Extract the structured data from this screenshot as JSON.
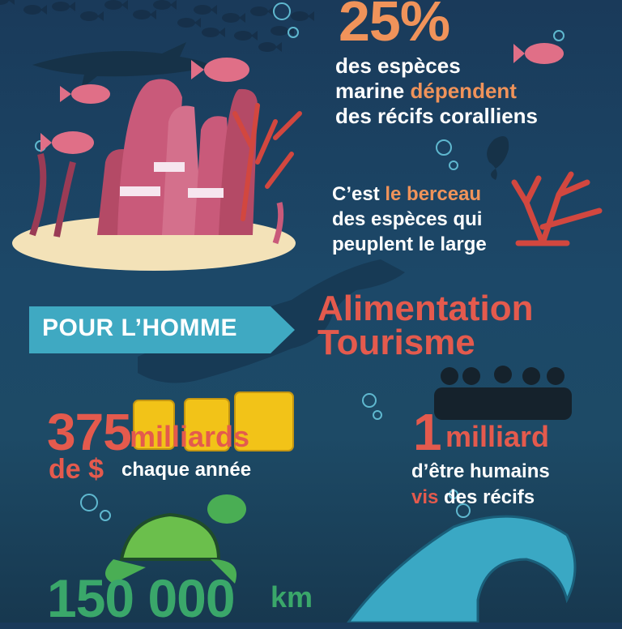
{
  "colors": {
    "background": "#1c4868",
    "accent_orange": "#f0935a",
    "accent_red": "#e45a4d",
    "accent_green": "#3aa76a",
    "coral_pink": "#c95a7a",
    "sand": "#f3e2b8",
    "wave": "#3aa8c4"
  },
  "stat_species": {
    "value": "25%",
    "line1": "des espèces",
    "line2_a": "marine ",
    "line2_b": "dépendent",
    "line3": "des récifs coralliens"
  },
  "berceau": {
    "line1_a": "C’est ",
    "line1_b": "le berceau",
    "line2": "des espèces qui",
    "line3": "peuplent le large"
  },
  "pour_homme": {
    "label": "POUR L’HOMME",
    "item1": "Alimentation",
    "item2": "Tourisme"
  },
  "money": {
    "number": "375",
    "unit": "milliards",
    "currency": "de $",
    "period": "chaque année"
  },
  "people": {
    "number": "1",
    "unit": "milliard",
    "line1": "d’être humains",
    "line2_a": "vis",
    "line2_b": " des récifs"
  },
  "coast": {
    "number": "150 000",
    "unit": "km"
  },
  "icons": [
    "fish-school-icon",
    "shark-icon",
    "fish-icon",
    "coral-reef-icon",
    "seahorse-icon",
    "diver-icon",
    "gold-coins-icon",
    "people-group-icon",
    "turtle-icon",
    "wave-icon",
    "bubbles-icon"
  ]
}
